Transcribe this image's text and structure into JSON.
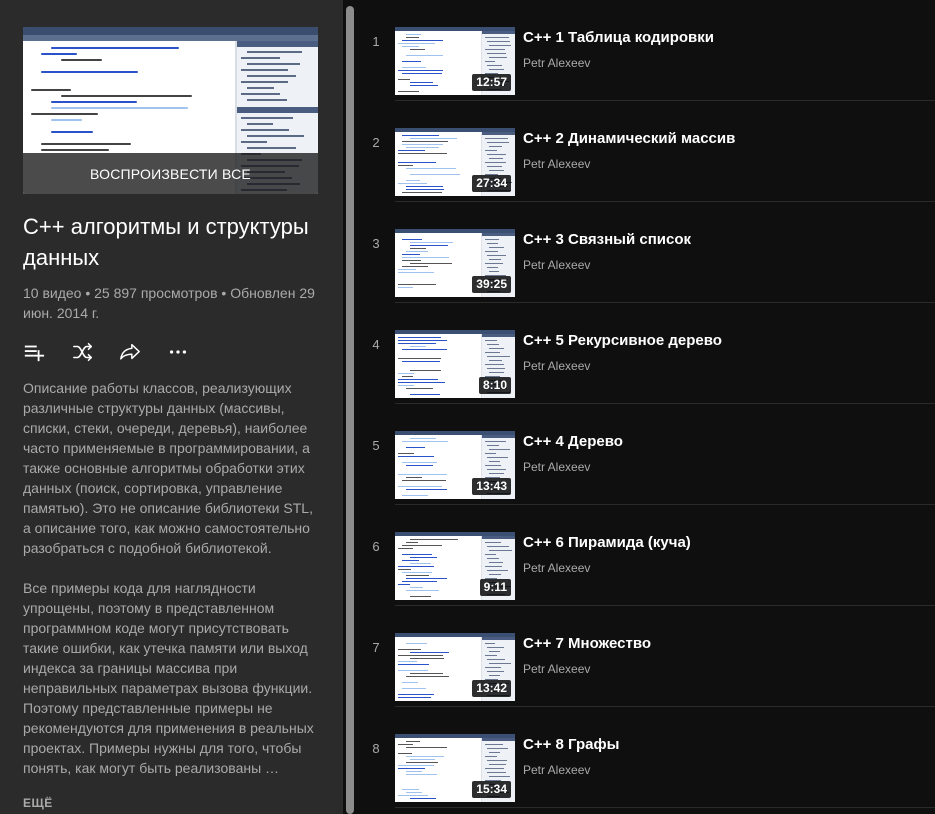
{
  "playlist": {
    "play_all_label": "ВОСПРОИЗВЕСТИ ВСЕ",
    "title": "C++ алгоритмы и структуры данных",
    "stats": "10 видео • 25 897 просмотров • Обновлен 29 июн. 2014 г.",
    "actions": [
      {
        "name": "add-to-queue",
        "icon": "playlist-add-icon"
      },
      {
        "name": "shuffle",
        "icon": "shuffle-icon"
      },
      {
        "name": "share",
        "icon": "share-icon"
      },
      {
        "name": "more",
        "icon": "more-horizontal-icon"
      }
    ],
    "description_p1": "Описание работы классов, реализующих различные структуры данных (массивы, списки, стеки, очереди, деревья), наиболее часто применяемые в программировании, а также основные алгоритмы обработки этих данных (поиск, сортировка, управление памятью). Это не описание библиотеки STL, а описание того, как можно самостоятельно разобраться с подобной библиотекой.",
    "description_p2": "Все примеры кода для наглядности упрощены, поэтому в представленном программном коде могут присутствовать такие ошибки, как утечка памяти или выход индекса за границы массива при неправильных параметрах вызова функции. Поэтому представленные примеры не рекомендуются для применения в реальных проектах. Примеры нужны для того, чтобы понять, как могут быть реализованы …",
    "more_label": "ЕЩЁ"
  },
  "videos": [
    {
      "index": "1",
      "title": "C++ 1 Таблица кодировки",
      "channel": "Petr Alexeev",
      "duration": "12:57"
    },
    {
      "index": "2",
      "title": "C++ 2 Динамический массив",
      "channel": "Petr Alexeev",
      "duration": "27:34"
    },
    {
      "index": "3",
      "title": "C++ 3 Связный список",
      "channel": "Petr Alexeev",
      "duration": "39:25"
    },
    {
      "index": "4",
      "title": "C++ 5 Рекурсивное дерево",
      "channel": "Petr Alexeev",
      "duration": "8:10"
    },
    {
      "index": "5",
      "title": "C++ 4 Дерево",
      "channel": "Petr Alexeev",
      "duration": "13:43"
    },
    {
      "index": "6",
      "title": "C++ 6 Пирамида (куча)",
      "channel": "Petr Alexeev",
      "duration": "9:11"
    },
    {
      "index": "7",
      "title": "C++ 7 Множество",
      "channel": "Petr Alexeev",
      "duration": "13:42"
    },
    {
      "index": "8",
      "title": "C++ 8 Графы",
      "channel": "Petr Alexeev",
      "duration": "15:34"
    }
  ],
  "colors": {
    "background": "#0f0f0f",
    "panel": "#2b2b2b",
    "secondary_text": "#aaaaaa",
    "code_keyword": "#2b53c9",
    "code_highlight": "#9fc2ee"
  }
}
